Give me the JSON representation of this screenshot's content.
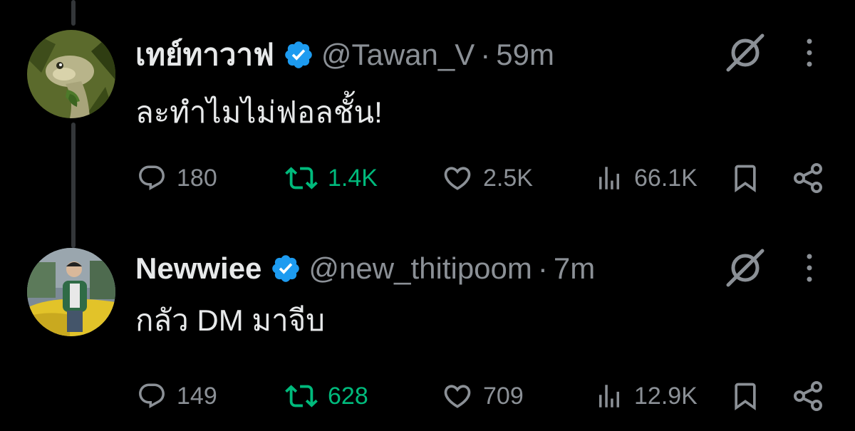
{
  "tweets": [
    {
      "display_name": "เทย์ทาวาฟ",
      "handle": "@Tawan_V",
      "separator": "·",
      "time": "59m",
      "text": "ละทำไมไม่ฟอลชั้น!",
      "replies": "180",
      "retweets": "1.4K",
      "likes": "2.5K",
      "views": "66.1K"
    },
    {
      "display_name": "Newwiee",
      "handle": "@new_thitipoom",
      "separator": "·",
      "time": "7m",
      "text": "กลัว DM มาจีบ",
      "replies": "149",
      "retweets": "628",
      "likes": "709",
      "views": "12.9K"
    }
  ],
  "icons": {
    "verified": "verified-badge-icon",
    "reply": "reply-icon",
    "retweet": "retweet-icon",
    "like": "heart-icon",
    "views": "views-icon",
    "bookmark": "bookmark-icon",
    "share": "share-icon",
    "grok": "grok-icon",
    "more": "more-options-icon"
  },
  "colors": {
    "background": "#000000",
    "text": "#e7e9ea",
    "secondary": "#8b9096",
    "verified": "#1d9bf0",
    "retweet": "#00ba7c"
  }
}
